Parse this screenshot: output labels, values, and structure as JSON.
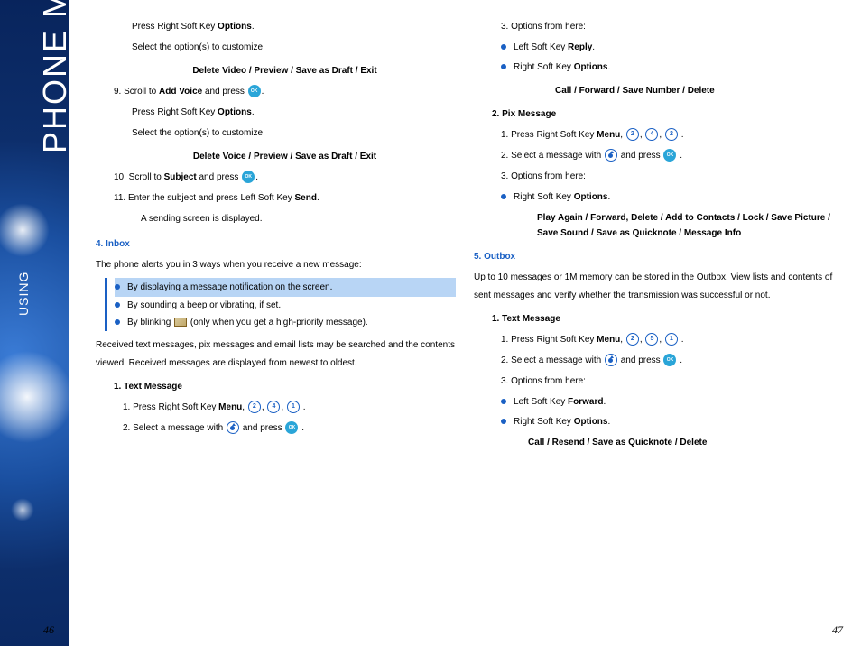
{
  "sidebar": {
    "using": "USING",
    "title": "PHONE MENUS"
  },
  "left": {
    "p1": "Press Right Soft Key ",
    "p1b": "Options",
    "p1e": ".",
    "p2": "Select the option(s) to customize.",
    "opt1": "Delete Video / Preview / Save as Draft / Exit",
    "s9a": "9. Scroll to ",
    "s9b": "Add Voice",
    "s9c": " and press ",
    "s9d": ".",
    "p3": "Press Right Soft Key ",
    "p3b": "Options",
    "p3e": ".",
    "p4": "Select the option(s) to customize.",
    "opt2": "Delete Voice / Preview / Save as Draft / Exit",
    "s10a": "10. Scroll to ",
    "s10b": "Subject",
    "s10c": " and press ",
    "s10d": ".",
    "s11a": "11. Enter the subject and press Left Soft Key ",
    "s11b": "Send",
    "s11e": ".",
    "s11f": "A sending screen is displayed.",
    "inbox_head": "4. Inbox",
    "inbox_intro": "The phone alerts you in 3 ways when you receive a new message:",
    "hl1": "By displaying a message notification on the screen.",
    "hl2": "By sounding a beep or vibrating, if set.",
    "hl3a": "By blinking ",
    "hl3b": " (only when you get a high-priority message).",
    "inbox_body": "Received text messages, pix messages and email lists may be searched and the contents viewed. Received messages are displayed from newest to oldest.",
    "tm_head": "1. Text Message",
    "tm_s1a": "1. Press Right Soft Key ",
    "tm_s1b": "Menu",
    "tm_s1c": ", ",
    "tm_s1_n1": "2",
    "tm_s1_n2": "4",
    "tm_s1_n3": "1",
    "tm_s1d": " .",
    "tm_s2a": "2. Select a message with ",
    "tm_s2b": " and press ",
    "tm_s2c": " ."
  },
  "right": {
    "s3": "3. Options from here:",
    "b1a": "Left Soft Key ",
    "b1b": "Reply",
    "b1c": ".",
    "b2a": "Right Soft Key ",
    "b2b": "Options",
    "b2c": ".",
    "opts1": "Call / Forward / Save Number / Delete",
    "pm_head": "2. Pix Message",
    "pm_s1a": "1. Press Right Soft Key ",
    "pm_s1b": "Menu",
    "pm_n1": "2",
    "pm_n2": "4",
    "pm_n3": "2",
    "pm_s2a": "2. Select a message with ",
    "pm_s2b": " and press ",
    "pm_s3": "3. Options from here:",
    "pm_b1a": "Right Soft Key ",
    "pm_b1b": "Options",
    "pm_b1c": ".",
    "pm_opts": "Play Again / Forward, Delete / Add to Contacts / Lock / Save Picture / Save Sound / Save as Quicknote / Message Info",
    "outbox_head": "5. Outbox",
    "outbox_intro": "Up to 10 messages or 1M memory can be stored in the Outbox. View lists and contents of sent messages and verify whether the transmission was successful or not.",
    "ob_tm_head": "1. Text Message",
    "ob_s1a": "1. Press Right Soft Key ",
    "ob_s1b": "Menu",
    "ob_n1": "2",
    "ob_n2": "5",
    "ob_n3": "1",
    "ob_s2a": "2. Select a message with ",
    "ob_s2b": " and press ",
    "ob_s3": "3. Options from here:",
    "ob_b1a": "Left Soft Key ",
    "ob_b1b": "Forward",
    "ob_b1c": ".",
    "ob_b2a": "Right Soft Key ",
    "ob_b2b": "Options",
    "ob_b2c": ".",
    "ob_opts": "Call / Resend / Save as Quicknote / Delete"
  },
  "page_left": "46",
  "page_right": "47",
  "icons": {
    "ok": "MENU OK",
    "comma": ", ",
    "period": " ."
  }
}
